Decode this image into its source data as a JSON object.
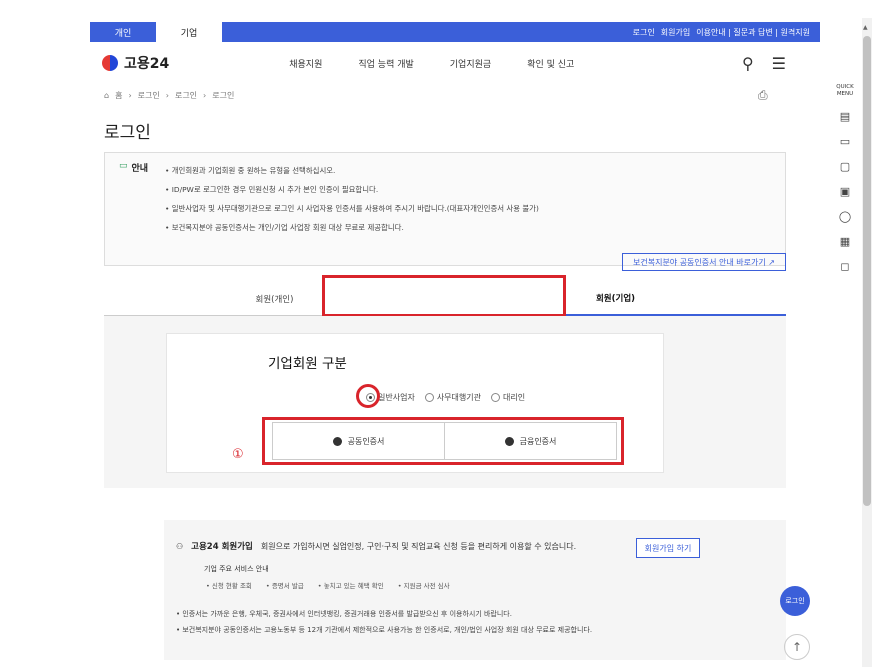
{
  "topbar": {
    "tabs": [
      "개인",
      "기업"
    ],
    "links": [
      "로그인",
      "회원가입",
      "이용안내 | 질문과 답변 | 원격지원"
    ]
  },
  "header": {
    "logo": "고용24",
    "gnb": [
      "채용지원",
      "직업 능력 개발",
      "기업지원금",
      "확인 및 신고"
    ],
    "search_icon": "⚲",
    "menu_icon": "☰"
  },
  "breadcrumb": [
    "홈",
    "로그인",
    "로그인",
    "로그인"
  ],
  "page_title": "로그인",
  "notice": {
    "title": "안내",
    "items": [
      "개인회원과 기업회원 중 원하는 유형을 선택하십시오.",
      "ID/PW로 로그인한 경우 민원신청 시 추가 본인 인증이 필요합니다.",
      "일반사업자 및 사무대행기관으로 로그인 시 사업자용 인증서를 사용하여 주시기 바랍니다.(대표자개인인증서 사용 불가)",
      "보건복지분야 공동인증서는 개인/기업 사업장 회원 대상 무료로 제공합니다."
    ]
  },
  "cert_link": "보건복지분야 공동인증서 안내 바로가기 ↗",
  "tabs": [
    "회원(개인)",
    "회원(기업)"
  ],
  "panel": {
    "title": "기업회원 구분",
    "radios": [
      "일반사업자",
      "사무대행기관",
      "대리인"
    ],
    "buttons": [
      "공동인증서",
      "금융인증서"
    ],
    "marker": "①"
  },
  "join": {
    "title": "고용24 회원가입",
    "desc": "회원으로 가입하시면 실업인정, 구인·구직 및 직업교육 신청 등을 편리하게 이용할 수 있습니다.",
    "button": "회원가입 하기",
    "svc_title": "기업 주요 서비스 안내",
    "services": [
      "• 신청 현황 조회",
      "• 증명서 발급",
      "• 놓치고 있는 혜택 확인",
      "• 지원금 사전 심사"
    ],
    "notes": [
      "인증서는 가까운 은행, 우체국, 증권사에서 인터넷뱅킹, 증권거래용 인증서를 발급받으신 후 이용하시기 바랍니다.",
      "보건복지분야 공동인증서는 고용노동부 등 12개 기관에서 제한적으로 사용가능 한 인증서로, 개인/법인 사업장 회원 대상 무료로 제공합니다."
    ]
  },
  "float": {
    "login": "로그인",
    "top": "↑"
  },
  "quick": {
    "title": "QUICK MENU",
    "icons": [
      "▤",
      "▭",
      "▢",
      "▣",
      "◯",
      "▦",
      "◻"
    ]
  }
}
